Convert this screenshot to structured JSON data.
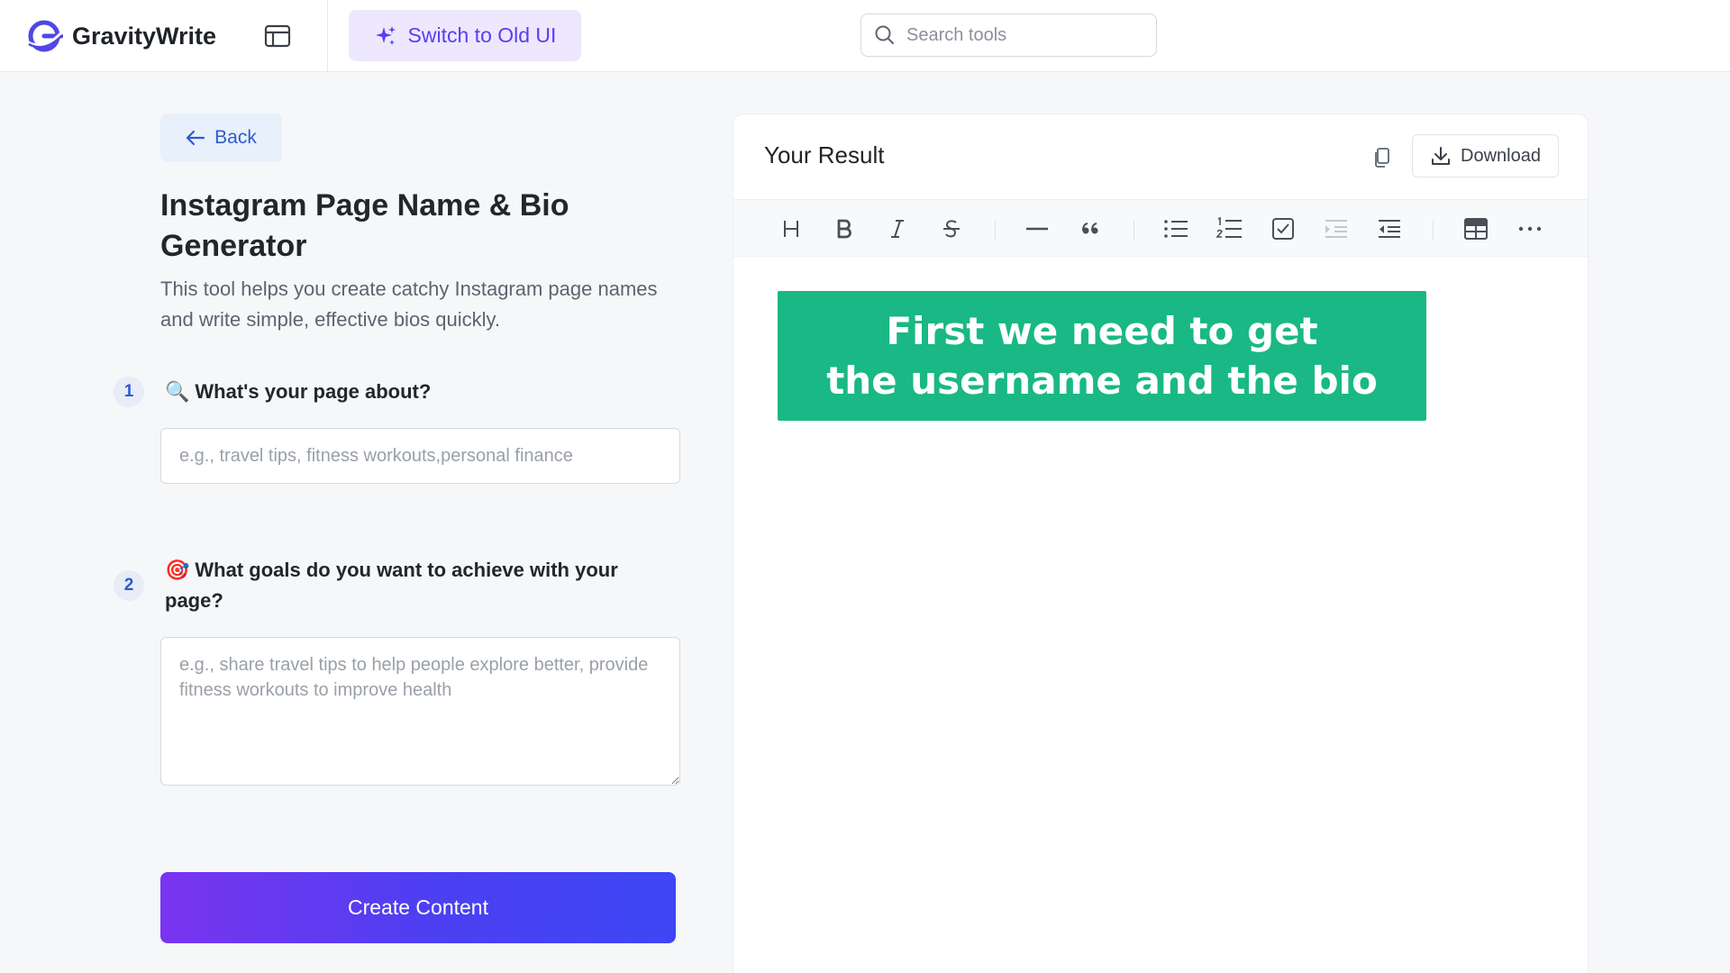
{
  "header": {
    "brand_name": "GravityWrite",
    "switch_label": "Switch to Old UI",
    "search_placeholder": "Search tools"
  },
  "left": {
    "back_label": "Back",
    "title": "Instagram Page Name & Bio Generator",
    "description": "This tool helps you create catchy Instagram page names and write simple, effective bios quickly.",
    "questions": [
      {
        "number": "1",
        "emoji": "🔍",
        "label": "What's your page about?",
        "placeholder": "e.g., travel tips, fitness workouts,personal finance",
        "value": ""
      },
      {
        "number": "2",
        "emoji": "🎯",
        "label": "What goals do you want to achieve with your page?",
        "placeholder": "e.g., share travel tips to help people explore better, provide fitness workouts to improve health",
        "value": ""
      }
    ],
    "create_label": "Create Content"
  },
  "result": {
    "title": "Your Result",
    "download_label": "Download",
    "toolbar": [
      "heading",
      "bold",
      "italic",
      "strikethrough",
      "horizontal-rule",
      "blockquote",
      "bullet-list",
      "ordered-list",
      "task-list",
      "indent",
      "outdent",
      "table",
      "more"
    ]
  },
  "overlay": {
    "line1": "First we need to get",
    "line2": "the username and the bio"
  },
  "colors": {
    "brand_accent": "#5b3df0",
    "banner_green": "#19b885",
    "create_gradient_start": "#7a34f0",
    "create_gradient_end": "#3e46f5"
  }
}
